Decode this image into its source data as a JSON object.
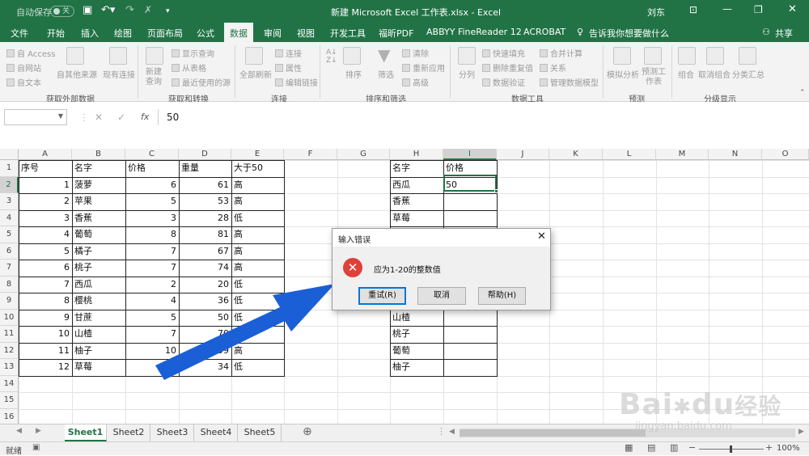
{
  "titlebar": {
    "autosave_label": "自动保存",
    "autosave_state": "关",
    "title": "新建 Microsoft Excel 工作表.xlsx  -  Excel",
    "user": "刘东"
  },
  "ribbon_tabs": [
    "文件",
    "开始",
    "插入",
    "绘图",
    "页面布局",
    "公式",
    "数据",
    "审阅",
    "视图",
    "开发工具",
    "福昕PDF",
    "ABBYY FineReader 12",
    "ACROBAT"
  ],
  "tell_me": "告诉我你想要做什么",
  "share": "共享",
  "ribbon": {
    "ext_data": {
      "access": "自 Access",
      "web": "自网站",
      "text": "自文本",
      "other": "自其他来源",
      "existing": "现有连接",
      "label": "获取外部数据"
    },
    "transform": {
      "new_query": "新建查询",
      "show_queries": "显示查询",
      "from_table": "从表格",
      "recent": "最近使用的源",
      "label": "获取和转换"
    },
    "connections": {
      "refresh_all": "全部刷新",
      "connections": "连接",
      "properties": "属性",
      "edit_links": "编辑链接",
      "label": "连接"
    },
    "sort_filter": {
      "sort": "排序",
      "filter": "筛选",
      "clear": "清除",
      "reapply": "重新应用",
      "advanced": "高级",
      "label": "排序和筛选"
    },
    "data_tools": {
      "split": "分列",
      "flash_fill": "快速填充",
      "remove_dup": "删除重复值",
      "validation": "数据验证",
      "consolidate": "合并计算",
      "relations": "关系",
      "model": "管理数据模型",
      "label": "数据工具"
    },
    "forecast": {
      "whatif": "模拟分析",
      "forecast_sheet": "预测工作表",
      "label": "预测"
    },
    "outline": {
      "group": "组合",
      "ungroup": "取消组合",
      "subtotal": "分类汇总",
      "label": "分级显示"
    }
  },
  "formula_bar": {
    "fx": "fx",
    "value": "50"
  },
  "columns": [
    "A",
    "B",
    "C",
    "D",
    "E",
    "F",
    "G",
    "H",
    "I",
    "J",
    "K",
    "L",
    "M",
    "N",
    "O"
  ],
  "rows": [
    "1",
    "2",
    "3",
    "4",
    "5",
    "6",
    "7",
    "8",
    "9",
    "10",
    "11",
    "12",
    "13",
    "14",
    "15",
    "16"
  ],
  "table1": {
    "headers": [
      "序号",
      "名字",
      "价格",
      "重量",
      "大于50"
    ],
    "rows": [
      [
        "1",
        "菠萝",
        "6",
        "61",
        "高"
      ],
      [
        "2",
        "苹果",
        "5",
        "53",
        "高"
      ],
      [
        "3",
        "香蕉",
        "3",
        "28",
        "低"
      ],
      [
        "4",
        "葡萄",
        "8",
        "81",
        "高"
      ],
      [
        "5",
        "橘子",
        "7",
        "67",
        "高"
      ],
      [
        "6",
        "桃子",
        "7",
        "74",
        "高"
      ],
      [
        "7",
        "西瓜",
        "2",
        "20",
        "低"
      ],
      [
        "8",
        "樱桃",
        "4",
        "36",
        "低"
      ],
      [
        "9",
        "甘蔗",
        "5",
        "50",
        "低"
      ],
      [
        "10",
        "山楂",
        "7",
        "70",
        "高"
      ],
      [
        "11",
        "柚子",
        "10",
        "99",
        "高"
      ],
      [
        "12",
        "草莓",
        "3",
        "34",
        "低"
      ]
    ]
  },
  "table2": {
    "headers": [
      "名字",
      "价格"
    ],
    "rows": [
      [
        "西瓜",
        "50"
      ],
      [
        "香蕉",
        ""
      ],
      [
        "草莓",
        ""
      ],
      [
        "",
        ""
      ],
      [
        "",
        ""
      ],
      [
        "",
        ""
      ],
      [
        "",
        ""
      ],
      [
        "",
        ""
      ],
      [
        "山楂",
        ""
      ],
      [
        "桃子",
        ""
      ],
      [
        "葡萄",
        ""
      ],
      [
        "柚子",
        ""
      ]
    ]
  },
  "sheets": [
    "Sheet1",
    "Sheet2",
    "Sheet3",
    "Sheet4",
    "Sheet5"
  ],
  "status": {
    "ready": "就绪",
    "zoom": "100%"
  },
  "dialog": {
    "title": "输入错误",
    "message": "应为1-20的整数值",
    "retry": "重试(R)",
    "cancel": "取消",
    "help": "帮助(H)",
    "icon": "error-icon"
  },
  "watermark": {
    "brand": "Bai",
    "brand2": "du",
    "cn": "经验",
    "url": "jingyan.baidu.com"
  },
  "colors": {
    "excel_green": "#217346",
    "arrow": "#1a5fd6",
    "error": "#e0403a"
  }
}
